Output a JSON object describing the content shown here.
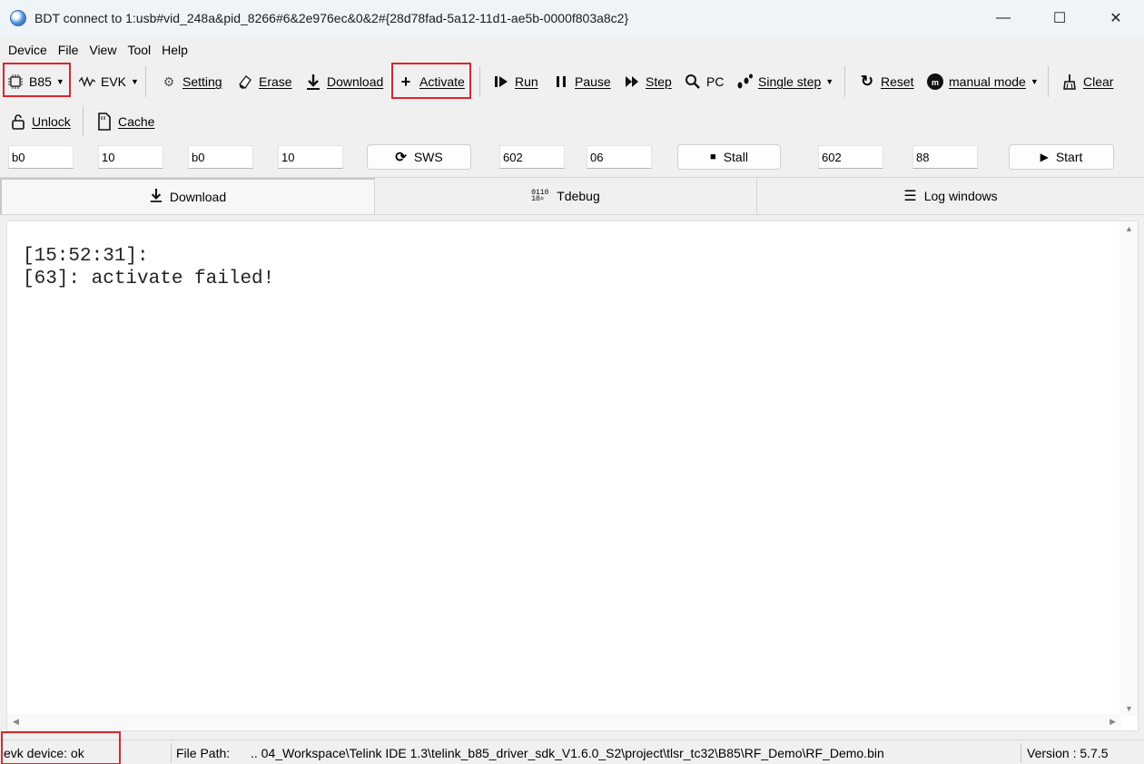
{
  "window": {
    "title": "BDT connect to 1:usb#vid_248a&pid_8266#6&2e976ec&0&2#{28d78fad-5a12-11d1-ae5b-0000f803a8c2}",
    "minimize": "—",
    "maximize": "☐",
    "close": "✕"
  },
  "menu": [
    "Device",
    "File",
    "View",
    "Tool",
    "Help"
  ],
  "toolbar": {
    "chip": "B85",
    "evk": "EVK",
    "setting": "Setting",
    "erase": "Erase",
    "download": "Download",
    "activate": "Activate",
    "run": "Run",
    "pause": "Pause",
    "step": "Step",
    "pc": "PC",
    "single_step": "Single step",
    "reset": "Reset",
    "manual_mode": "manual mode",
    "clear": "Clear",
    "unlock": "Unlock",
    "cache": "Cache"
  },
  "inputs": {
    "f1": "b0",
    "f2": "10",
    "f3": "b0",
    "f4": "10",
    "sws_label": "SWS",
    "f5": "602",
    "f6": "06",
    "stall_label": "Stall",
    "f7": "602",
    "f8": "88",
    "start_label": "Start"
  },
  "tabs": {
    "download": "Download",
    "tdebug": "Tdebug",
    "log_windows": "Log windows",
    "active": "download"
  },
  "log": {
    "lines": "[15:52:31]:\n[63]: activate failed!"
  },
  "status": {
    "device": "evk device: ok",
    "file_path_label": "File Path:",
    "file_path": "..  04_Workspace\\Telink IDE 1.3\\telink_b85_driver_sdk_V1.6.0_S2\\project\\tlsr_tc32\\B85\\RF_Demo\\RF_Demo.bin",
    "version": "Version : 5.7.5"
  },
  "colors": {
    "highlight": "#e0242b",
    "titlebar": "#eff4f9"
  }
}
